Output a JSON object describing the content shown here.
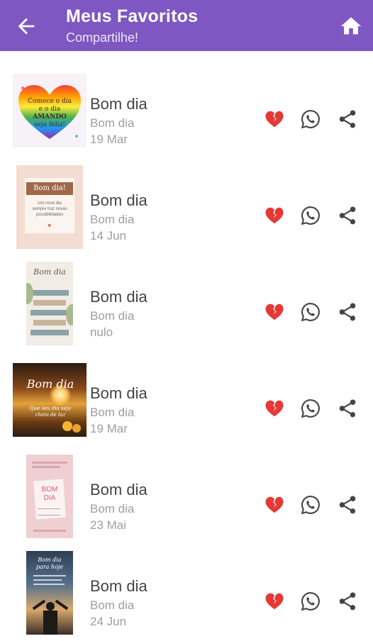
{
  "header": {
    "title": "Meus Favoritos",
    "subtitle": "Compartilhe!",
    "back_icon": "arrow-back-icon",
    "home_icon": "home-icon",
    "background": "#7e57c2"
  },
  "favorites": [
    {
      "title": "Bom dia",
      "subtitle": "Bom dia",
      "date": "19 Mar",
      "thumb_text": [
        "Comece o dia",
        "e o dia",
        "AMANDO",
        "seja feliz!"
      ]
    },
    {
      "title": "Bom dia",
      "subtitle": "Bom dia",
      "date": "14 Jun",
      "thumb_text": [
        "Bom dia!",
        "Um novo dia",
        "sempre traz novas",
        "possibilidades"
      ]
    },
    {
      "title": "Bom dia",
      "subtitle": "Bom dia",
      "date": "nulo",
      "thumb_text": [
        "Bom dia"
      ]
    },
    {
      "title": "Bom dia",
      "subtitle": "Bom dia",
      "date": "19 Mar",
      "thumb_text": [
        "Bom dia",
        "Que seu dia seja",
        "cheio de luz"
      ]
    },
    {
      "title": "Bom dia",
      "subtitle": "Bom dia",
      "date": "23 Mai",
      "thumb_text": [
        "BOM",
        "DIA"
      ]
    },
    {
      "title": "Bom dia",
      "subtitle": "Bom dia",
      "date": "24 Jun",
      "thumb_text": [
        "Bom dia",
        "para hoje"
      ]
    }
  ],
  "actions": {
    "remove_icon": "broken-heart-icon",
    "whatsapp_icon": "whatsapp-icon",
    "share_icon": "share-icon",
    "heart_color": "#e53935",
    "icon_color": "#444444"
  }
}
